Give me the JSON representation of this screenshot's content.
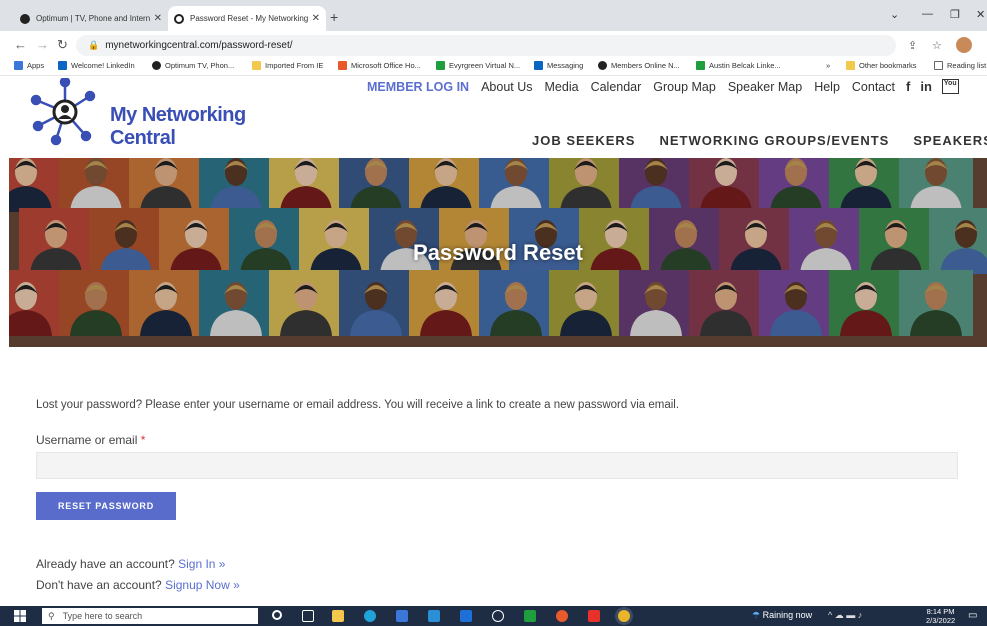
{
  "browser": {
    "tabs": [
      {
        "label": "Optimum | TV, Phone and Intern"
      },
      {
        "label": "Password Reset - My Networking"
      }
    ],
    "new_tab": "+",
    "url": "mynetworkingcentral.com/password-reset/",
    "bookmarks": [
      {
        "label": "Apps",
        "color": "#3a77d8"
      },
      {
        "label": "Welcome! LinkedIn",
        "color": "#0a66c2"
      },
      {
        "label": "Optimum TV, Phon...",
        "color": "#222222"
      },
      {
        "label": "Imported From IE",
        "color": "#f2c94c"
      },
      {
        "label": "Microsoft Office Ho...",
        "color": "#e85a2a"
      },
      {
        "label": "Evyrgreen Virtual N...",
        "color": "#1f9e3e"
      },
      {
        "label": "Messaging",
        "color": "#0a66c2"
      },
      {
        "label": "Members Online N...",
        "color": "#222222"
      },
      {
        "label": "Austin Belcak Linke...",
        "color": "#1f9e3e"
      }
    ],
    "bookmarks_more": "»",
    "other_bookmarks": "Other bookmarks",
    "reading_list": "Reading list"
  },
  "site": {
    "logo_text": "My Networking Central",
    "top_nav": [
      "MEMBER LOG IN",
      "About Us",
      "Media",
      "Calendar",
      "Group Map",
      "Speaker Map",
      "Help",
      "Contact"
    ],
    "social": [
      "f",
      "in",
      "You"
    ],
    "main_nav": [
      "JOB SEEKERS",
      "NETWORKING GROUPS/EVENTS",
      "SPEAKERS"
    ],
    "accent": "#5a6ccb"
  },
  "hero": {
    "title": "Password Reset"
  },
  "form": {
    "intro": "Lost your password? Please enter your username or email address. You will receive a link to create a new password via email.",
    "label": "Username or email",
    "required_mark": "*",
    "input_value": "",
    "button_label": "RESET PASSWORD",
    "have_account": "Already have an account?",
    "sign_in": "Sign In »",
    "no_account": "Don't have an account?",
    "sign_up": "Signup Now »"
  },
  "taskbar": {
    "search_placeholder": "Type here to search",
    "weather": "Raining now",
    "time": "8:14 PM",
    "date": "2/3/2022"
  }
}
